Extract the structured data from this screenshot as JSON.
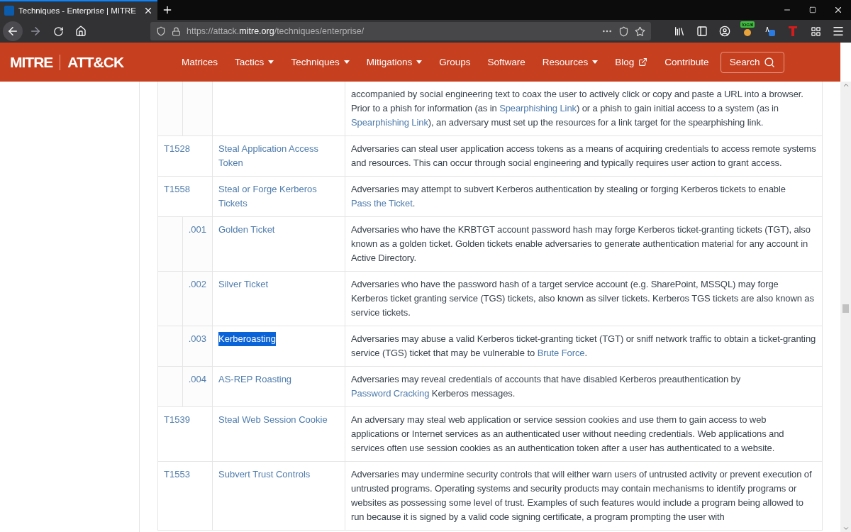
{
  "browser": {
    "tab_title": "Techniques - Enterprise | MITRE",
    "url_prefix": "https://attack.",
    "url_domain": "mitre.org",
    "url_path": "/techniques/enterprise/",
    "badge": "local"
  },
  "nav": {
    "logo_left": "MITRE",
    "logo_right": "ATT&CK",
    "items": [
      {
        "label": "Matrices",
        "kind": "plain"
      },
      {
        "label": "Tactics",
        "kind": "dropdown"
      },
      {
        "label": "Techniques",
        "kind": "dropdown"
      },
      {
        "label": "Mitigations",
        "kind": "dropdown"
      },
      {
        "label": "Groups",
        "kind": "plain"
      },
      {
        "label": "Software",
        "kind": "plain"
      },
      {
        "label": "Resources",
        "kind": "dropdown"
      },
      {
        "label": "Blog",
        "kind": "external"
      },
      {
        "label": "Contribute",
        "kind": "plain"
      }
    ],
    "search": "Search"
  },
  "rows": [
    {
      "id": "",
      "name": "",
      "description": [
        {
          "kind": "text",
          "text": "accompanied by social engineering text to coax the user to actively click or copy and paste a URL into a browser. Prior to a phish for information (as in "
        },
        {
          "kind": "link",
          "text": "Spearphishing Link"
        },
        {
          "kind": "text",
          "text": ") or a phish to gain initial access to a system (as in "
        },
        {
          "kind": "link",
          "text": "Spearphishing Link"
        },
        {
          "kind": "text",
          "text": "), an adversary must set up the resources for a link target for the spearphishing link."
        }
      ],
      "sub": true
    },
    {
      "id": "T1528",
      "name": "Steal Application Access Token",
      "highlighted": false,
      "sub": false,
      "description": [
        {
          "kind": "text",
          "text": "Adversaries can steal user application access tokens as a means of acquiring credentials to access remote systems and resources. This can occur through social engineering and typically requires user action to grant access."
        }
      ]
    },
    {
      "id": "T1558",
      "name": "Steal or Forge Kerberos Tickets",
      "highlighted": false,
      "sub": false,
      "description": [
        {
          "kind": "text",
          "text": "Adversaries may attempt to subvert Kerberos authentication by stealing or forging Kerberos tickets to enable "
        },
        {
          "kind": "link",
          "text": "Pass the Ticket"
        },
        {
          "kind": "text",
          "text": "."
        }
      ]
    },
    {
      "id": ".001",
      "name": "Golden Ticket",
      "highlighted": false,
      "sub": true,
      "description": [
        {
          "kind": "text",
          "text": "Adversaries who have the KRBTGT account password hash may forge Kerberos ticket-granting tickets (TGT), also known as a golden ticket. Golden tickets enable adversaries to generate authentication material for any account in Active Directory."
        }
      ]
    },
    {
      "id": ".002",
      "name": "Silver Ticket",
      "highlighted": false,
      "sub": true,
      "description": [
        {
          "kind": "text",
          "text": "Adversaries who have the password hash of a target service account (e.g. SharePoint, MSSQL) may forge Kerberos ticket granting service (TGS) tickets, also known as silver tickets. Kerberos TGS tickets are also known as service tickets."
        }
      ]
    },
    {
      "id": ".003",
      "name": "Kerberoasting",
      "highlighted": true,
      "sub": true,
      "description": [
        {
          "kind": "text",
          "text": "Adversaries may abuse a valid Kerberos ticket-granting ticket (TGT) or sniff network traffic to obtain a ticket-granting service (TGS) ticket that may be vulnerable to "
        },
        {
          "kind": "link",
          "text": "Brute Force"
        },
        {
          "kind": "text",
          "text": "."
        }
      ]
    },
    {
      "id": ".004",
      "name": "AS-REP Roasting",
      "highlighted": false,
      "sub": true,
      "description": [
        {
          "kind": "text",
          "text": "Adversaries may reveal credentials of accounts that have disabled Kerberos preauthentication by "
        },
        {
          "kind": "link",
          "text": "Password Cracking"
        },
        {
          "kind": "text",
          "text": " Kerberos messages."
        }
      ]
    },
    {
      "id": "T1539",
      "name": "Steal Web Session Cookie",
      "highlighted": false,
      "sub": false,
      "description": [
        {
          "kind": "text",
          "text": "An adversary may steal web application or service session cookies and use them to gain access to web applications or Internet services as an authenticated user without needing credentials. Web applications and services often use session cookies as an authentication token after a user has authenticated to a website."
        }
      ]
    },
    {
      "id": "T1553",
      "name": "Subvert Trust Controls",
      "highlighted": false,
      "sub": false,
      "description": [
        {
          "kind": "text",
          "text": "Adversaries may undermine security controls that will either warn users of untrusted activity or prevent execution of untrusted programs. Operating systems and security products may contain mechanisms to identify programs or websites as possessing some level of trust. Examples of such features would include a program being allowed to run because it is signed by a valid code signing certificate, a program prompting the user with"
        }
      ]
    }
  ]
}
